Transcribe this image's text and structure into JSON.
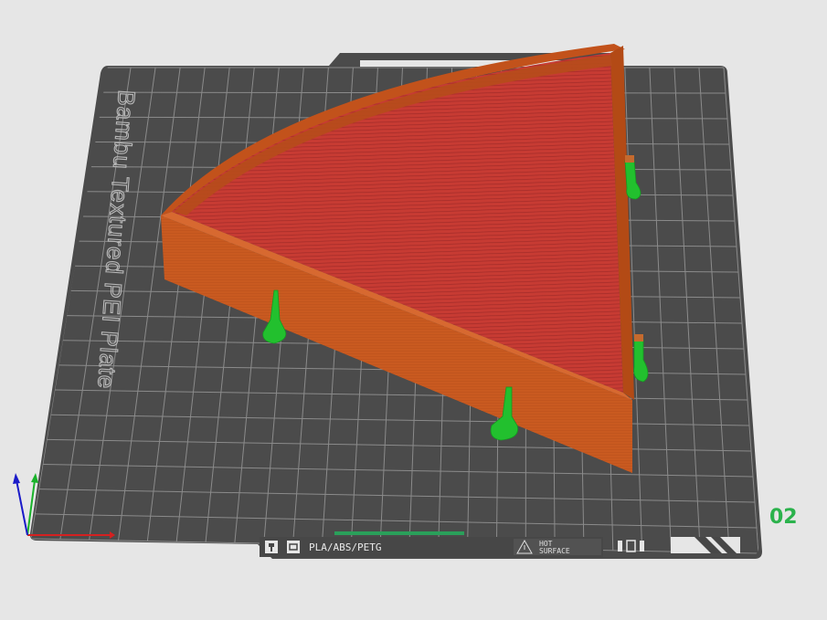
{
  "viewport": {
    "plate_name": "Bambu Textured PEI Plate",
    "plate_number": "02",
    "bed_strip": {
      "material_label": "PLA/ABS/PETG",
      "warning_line1": "HOT",
      "warning_line2": "SURFACE"
    }
  },
  "colors": {
    "background": "#e6e6e6",
    "bed": "#4a4a4a",
    "grid": "#8a8a8a",
    "model_wall": "#c8571e",
    "model_infill": "#cf3a36",
    "supports": "#22c02e",
    "plate_number": "#2bb24c",
    "axis_x": "#d42020",
    "axis_y": "#19b32a",
    "axis_z": "#1b1bc8"
  },
  "icons": [
    "nozzle-icon",
    "bed-icon",
    "warning-triangle-icon",
    "temperature-icon",
    "axis-gizmo-icon"
  ]
}
